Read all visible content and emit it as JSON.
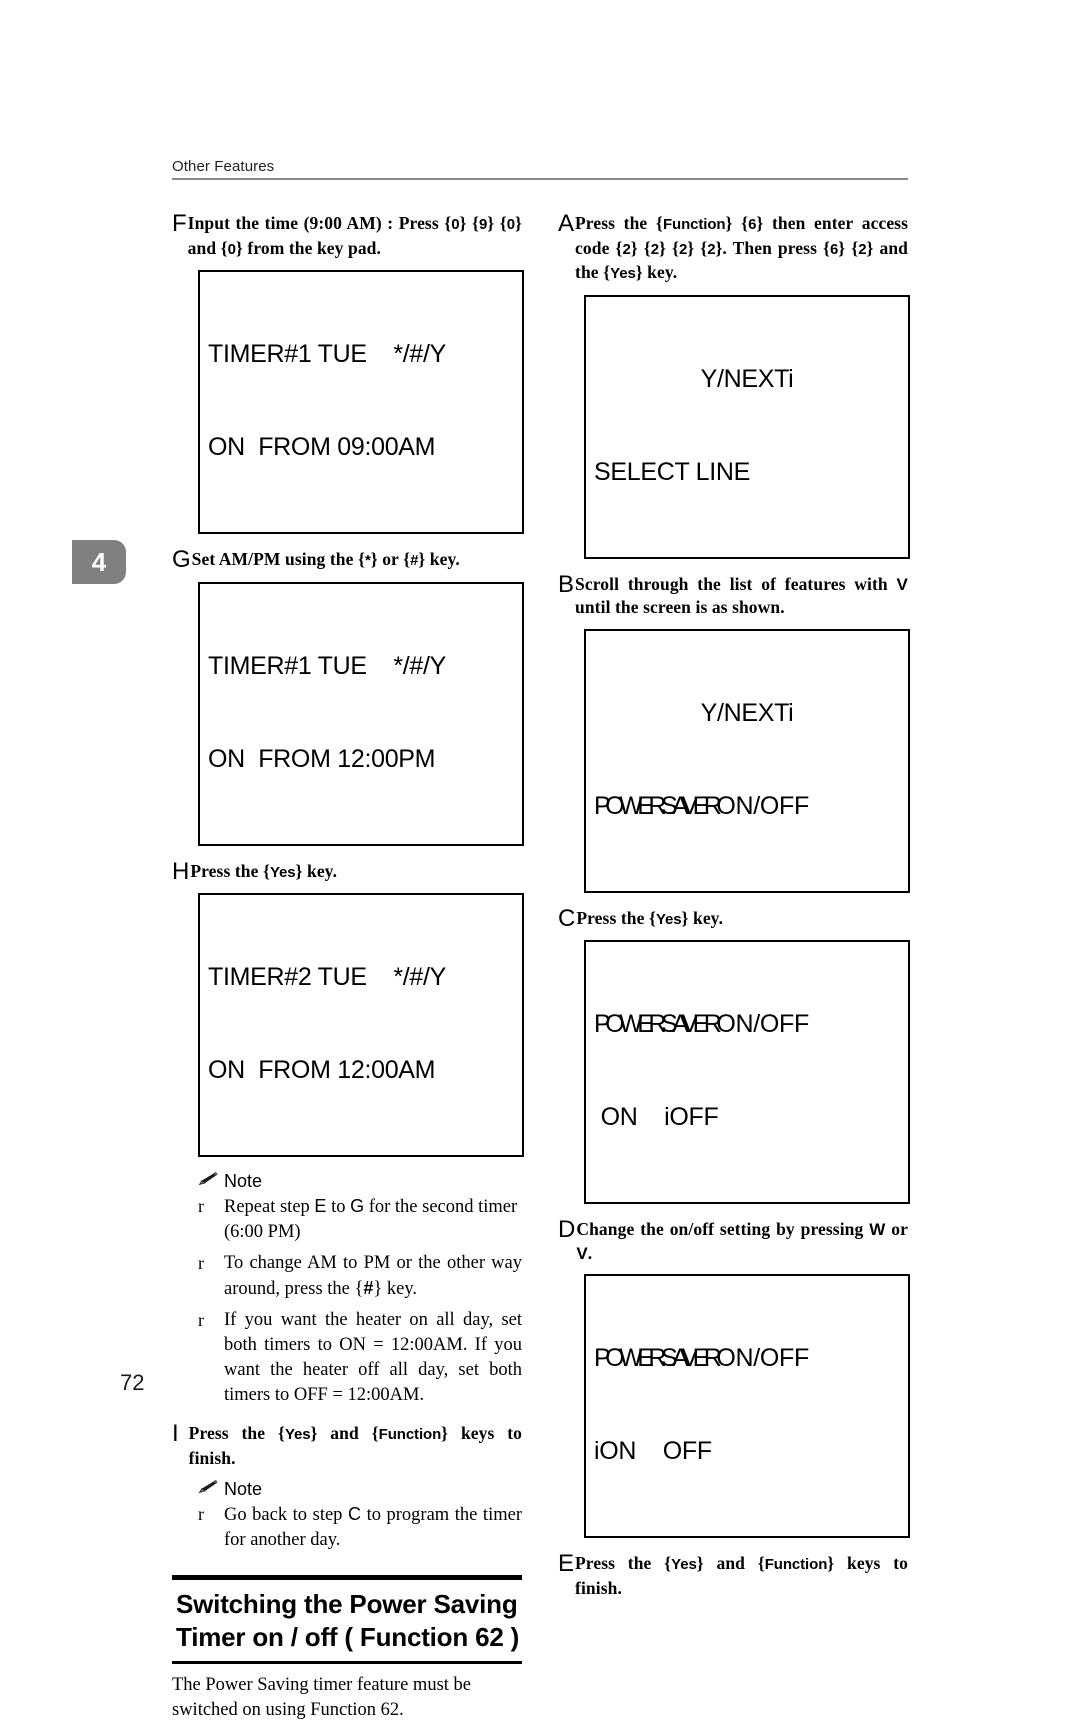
{
  "header": {
    "running_head": "Other Features"
  },
  "chapter_tab": {
    "number": "4"
  },
  "page_number": "72",
  "left_column": {
    "steps": [
      {
        "letter": "F",
        "text_parts": [
          {
            "t": "Input the time (9:00 AM) : Press ",
            "style": "serif"
          },
          {
            "t": "{",
            "style": "serif"
          },
          {
            "t": "0",
            "style": "key"
          },
          {
            "t": "} ",
            "style": "serif"
          },
          {
            "t": "{",
            "style": "serif"
          },
          {
            "t": "9",
            "style": "key"
          },
          {
            "t": "} ",
            "style": "serif"
          },
          {
            "t": "{",
            "style": "serif"
          },
          {
            "t": "0",
            "style": "key"
          },
          {
            "t": "} and ",
            "style": "serif"
          },
          {
            "t": "{",
            "style": "serif"
          },
          {
            "t": "0",
            "style": "key"
          },
          {
            "t": "} from the key pad.",
            "style": "serif"
          }
        ],
        "plain": "Input the time (9:00 AM) : Press {0} {9} {0} and {0} from the key pad."
      },
      {
        "letter": "G",
        "plain": "Set AM/PM using the {*} or {#} key."
      },
      {
        "letter": "H",
        "plain": "Press the {Yes} key."
      },
      {
        "letter": "I",
        "plain": "Press the {Yes} and {Function} keys to finish."
      }
    ],
    "lcd_screens": [
      {
        "id": "timer1-0900am",
        "line1": "TIMER#1 TUE    */#/Y",
        "line2": "ON  FROM 09:00AM"
      },
      {
        "id": "timer1-1200pm",
        "line1": "TIMER#1 TUE    */#/Y",
        "line2": "ON  FROM 12:00PM"
      },
      {
        "id": "timer2-1200am",
        "line1": "TIMER#2 TUE    */#/Y",
        "line2": "ON  FROM 12:00AM"
      }
    ],
    "note_1": {
      "label": "Note",
      "bullet_glyph": "r",
      "items": [
        "Repeat step E to G for the second timer (6:00 PM)",
        "To change AM to PM or the other way around, press the {#} key.",
        "If you want the heater on all day, set both timers to ON = 12:00AM. If you want the heater off all day, set both timers to OFF = 12:00AM."
      ]
    },
    "note_2": {
      "label": "Note",
      "bullet_glyph": "r",
      "items": [
        "Go back to step C to program the timer for another day."
      ]
    },
    "section": {
      "title_line1": "Switching the Power Saving",
      "title_line2": "Timer on / off ( Function 62 )",
      "body": "The  Power Saving timer feature must be switched on using Function 62."
    }
  },
  "right_column": {
    "steps": [
      {
        "letter": "A",
        "plain": "Press the {Function} {6} then enter access code {2} {2} {2} {2}. Then press {6} {2} and the {Yes} key."
      },
      {
        "letter": "B",
        "plain": "Scroll through the list of features with V until the screen is as shown."
      },
      {
        "letter": "C",
        "plain": "Press the {Yes} key."
      },
      {
        "letter": "D",
        "plain": "Change the on/off setting by pressing W or V."
      },
      {
        "letter": "E",
        "plain": "Press the {Yes} and {Function} keys to finish."
      }
    ],
    "lcd_screens": [
      {
        "id": "select-line",
        "line1": "Y/NEXTi",
        "line2": "SELECT LINE"
      },
      {
        "id": "power-saver-onoff-menu",
        "line1": "Y/NEXTi",
        "line2a": "POWER",
        "line2b": "SAVER",
        "line2c": "ON/OFF"
      },
      {
        "id": "power-saver-select-off",
        "line1a": "POWER",
        "line1b": "SAVER",
        "line1c": "ON/OFF",
        "line2": " ON    iOFF"
      },
      {
        "id": "power-saver-select-on",
        "line1a": "POWER",
        "line1b": "SAVER",
        "line1c": "ON/OFF",
        "line2": "iON    OFF"
      }
    ]
  },
  "keys": {
    "function": "Function",
    "yes": "Yes",
    "six": "6",
    "two": "2",
    "zero": "0",
    "nine": "9",
    "star": "*",
    "hash": "#"
  }
}
